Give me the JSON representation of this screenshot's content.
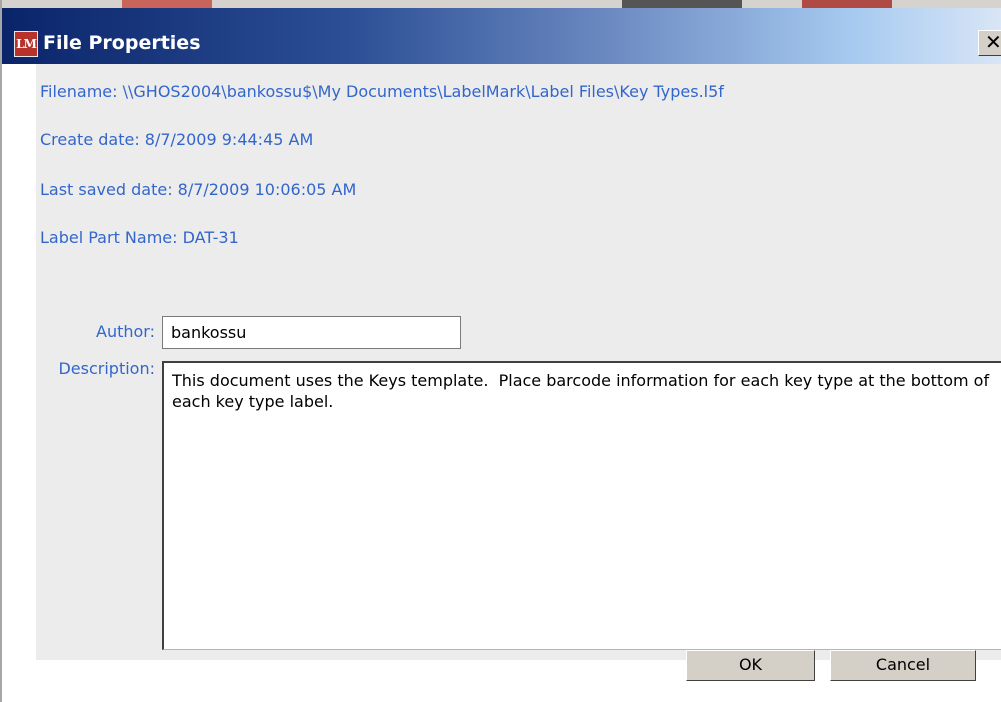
{
  "window": {
    "title": "File Properties",
    "app_icon_text": "LM",
    "close_glyph": "✕",
    "accent_color": "#3366cc",
    "titlebar_color": "#0a246a"
  },
  "info": {
    "filename": "Filename: \\\\GHOS2004\\bankossu$\\My Documents\\LabelMark\\Label Files\\Key Types.l5f",
    "create_date": "Create date: 8/7/2009 9:44:45 AM",
    "last_saved": "Last saved date: 8/7/2009 10:06:05 AM",
    "part_name": "Label Part Name: DAT-31"
  },
  "form": {
    "author_label": "Author:",
    "author_value": "bankossu",
    "description_label": "Description:",
    "description_value": "This document uses the Keys template.  Place barcode information for each key type at the bottom of each key type label."
  },
  "buttons": {
    "ok_label": "OK",
    "cancel_label": "Cancel"
  },
  "icons": {
    "app": "labelmark-app-icon",
    "close": "close-icon"
  }
}
